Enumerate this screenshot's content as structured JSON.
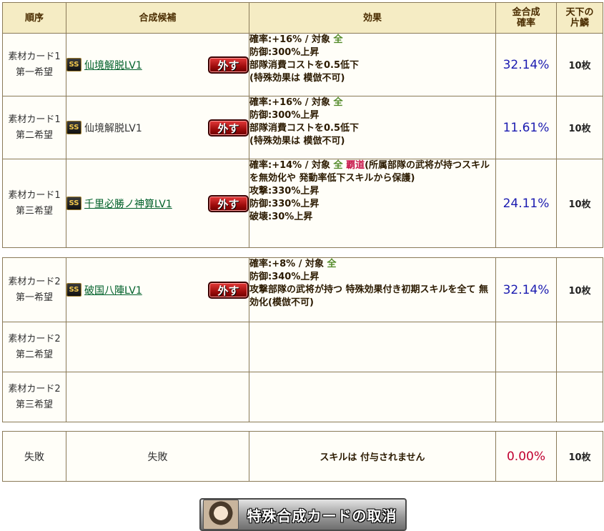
{
  "header": {
    "order": "順序",
    "candidate": "合成候補",
    "effect": "効果",
    "probability_line1": "金合成",
    "probability_line2": "確率",
    "scale_line1": "天下の",
    "scale_line2": "片鱗"
  },
  "remove_label": "外す",
  "ss_label": "SS",
  "rows": [
    {
      "order_line1": "素材カード1",
      "order_line2": "第一希望",
      "skill": "仙境解脱LV1",
      "effect_rate": "確率:+16%  /  対象 ",
      "effect_target": "全",
      "effect_lines": [
        "防御:300%上昇",
        "部隊消費コストを0.5低下",
        "(特殊効果は 模倣不可)"
      ],
      "probability": "32.14%",
      "scale": "10枚"
    },
    {
      "order_line1": "素材カード1",
      "order_line2": "第二希望",
      "skill": "仙境解脱LV1",
      "effect_rate": "確率:+16%  /  対象 ",
      "effect_target": "全",
      "effect_lines": [
        "防御:300%上昇",
        "部隊消費コストを0.5低下",
        "(特殊効果は 模倣不可)"
      ],
      "probability": "11.61%",
      "scale": "10枚"
    },
    {
      "order_line1": "素材カード1",
      "order_line2": "第三希望",
      "skill": "千里必勝ノ神算LV1",
      "effect_rate": "確率:+14%  /  対象 ",
      "effect_target": "全",
      "effect_special": "覇道",
      "effect_special_desc": "(所属部隊の武将が持つスキルを無効化や 発動率低下スキルから保護)",
      "effect_lines": [
        "攻撃:330%上昇",
        "防御:330%上昇",
        "破壊:30%上昇"
      ],
      "probability": "24.11%",
      "scale": "10枚"
    },
    {
      "order_line1": "素材カード2",
      "order_line2": "第一希望",
      "skill": "破国八陣LV1",
      "effect_rate": "確率:+8%  /  対象 ",
      "effect_target": "全",
      "effect_lines": [
        "防御:340%上昇",
        "攻撃部隊の武将が持つ 特殊効果付き初期スキルを全て 無効化(模倣不可)"
      ],
      "probability": "32.14%",
      "scale": "10枚"
    },
    {
      "order_line1": "素材カード2",
      "order_line2": "第二希望"
    },
    {
      "order_line1": "素材カード2",
      "order_line2": "第三希望"
    }
  ],
  "failure": {
    "order": "失敗",
    "candidate": "失敗",
    "effect": "スキルは 付与されません",
    "probability": "0.00%",
    "scale": "10枚"
  },
  "cancel_button": "特殊合成カードの取消"
}
